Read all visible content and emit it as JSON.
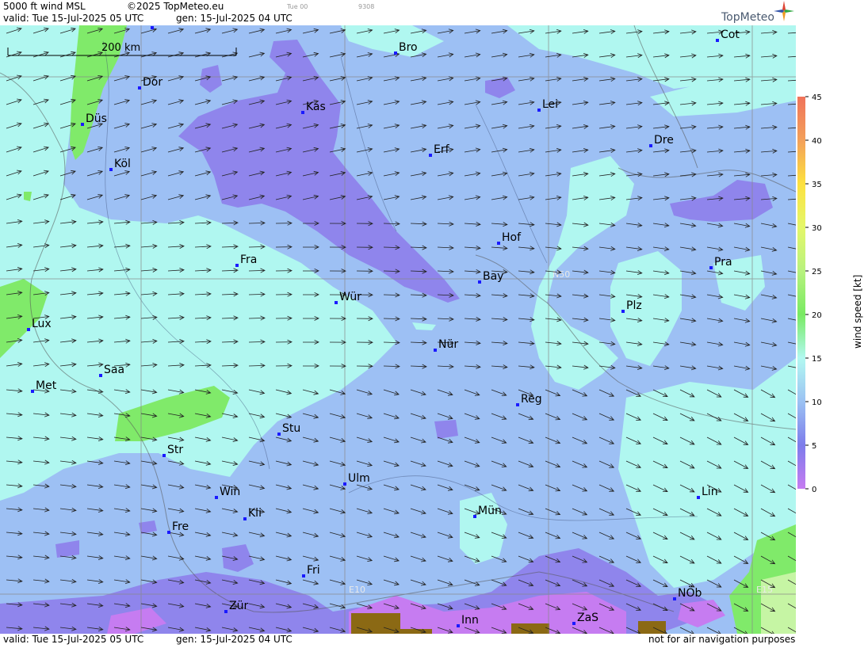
{
  "header": {
    "product": "5000 ft wind MSL",
    "copyright": "©2025 TopMeteo.eu",
    "run": "Tue 00",
    "code": "9308",
    "valid": "valid:  Tue  15-Jul-2025  05 UTC",
    "generated": "gen: 15-Jul-2025 04 UTC",
    "logo": "TopMeteo"
  },
  "footer": {
    "valid": "valid:  Tue  15-Jul-2025  05 UTC",
    "generated": "gen: 15-Jul-2025 04 UTC",
    "disclaimer": "not for air navigation purposes"
  },
  "scale_bar": {
    "label": "200 km"
  },
  "grid_labels": {
    "lat": "N50",
    "lon1": "E10",
    "lon2": "E15"
  },
  "cities": [
    {
      "name": "Mün",
      "label": "Mün"
    },
    {
      "name": "Bro",
      "label": "Bro"
    },
    {
      "name": "Cot",
      "label": "Cot"
    },
    {
      "name": "Dor",
      "label": "Dor"
    },
    {
      "name": "Kas",
      "label": "Kas"
    },
    {
      "name": "Lei",
      "label": "Lei"
    },
    {
      "name": "Düs",
      "label": "Düs"
    },
    {
      "name": "Dre",
      "label": "Dre"
    },
    {
      "name": "Erf",
      "label": "Erf"
    },
    {
      "name": "Köl",
      "label": "Köl"
    },
    {
      "name": "Hof",
      "label": "Hof"
    },
    {
      "name": "Fra",
      "label": "Fra"
    },
    {
      "name": "Pra",
      "label": "Pra"
    },
    {
      "name": "Bay",
      "label": "Bay"
    },
    {
      "name": "Würz",
      "label": "Wür"
    },
    {
      "name": "Plz",
      "label": "Plz"
    },
    {
      "name": "Lux",
      "label": "Lux"
    },
    {
      "name": "Nür",
      "label": "Nür"
    },
    {
      "name": "Saa",
      "label": "Saa"
    },
    {
      "name": "Met",
      "label": "Met"
    },
    {
      "name": "Reg",
      "label": "Reg"
    },
    {
      "name": "Stu",
      "label": "Stu"
    },
    {
      "name": "Str",
      "label": "Str"
    },
    {
      "name": "Ulm",
      "label": "Ulm"
    },
    {
      "name": "Lin",
      "label": "Lin"
    },
    {
      "name": "Win",
      "label": "Win"
    },
    {
      "name": "Kli",
      "label": "Kli"
    },
    {
      "name": "München",
      "label": "Mün"
    },
    {
      "name": "Fre",
      "label": "Fre"
    },
    {
      "name": "Fri",
      "label": "Fri"
    },
    {
      "name": "NÖb",
      "label": "NÖb"
    },
    {
      "name": "Zür",
      "label": "Zür"
    },
    {
      "name": "ZaS",
      "label": "ZaS"
    },
    {
      "name": "Inn",
      "label": "Inn"
    }
  ],
  "legend": {
    "title": "wind speed [kt]",
    "unit": "kt",
    "stops": [
      {
        "value": "45",
        "color": "#f0735a"
      },
      {
        "value": "40",
        "color": "#f3a05a"
      },
      {
        "value": "35",
        "color": "#fde13f"
      },
      {
        "value": "30",
        "color": "#e4f76a"
      },
      {
        "value": "25",
        "color": "#b8f27e"
      },
      {
        "value": "20",
        "color": "#78ea62"
      },
      {
        "value": "15",
        "color": "#b2f9f1"
      },
      {
        "value": "10",
        "color": "#9bc2f3"
      },
      {
        "value": "5",
        "color": "#7d7ceb"
      },
      {
        "value": "0",
        "color": "#c67cf1"
      }
    ]
  },
  "colors": {
    "calm": "#c67cf1",
    "low": "#8f85ec",
    "mid": "#9dc0f4",
    "med": "#b0f7f0",
    "high": "#80ea6a",
    "terrain": "#8b6914"
  }
}
